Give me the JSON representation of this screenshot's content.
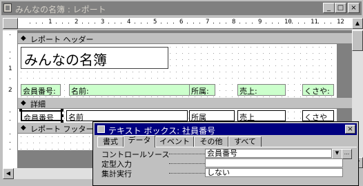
{
  "window": {
    "title": "みんなの名簿 : レポート",
    "minimize": "_",
    "maximize": "□",
    "close": "×"
  },
  "ruler": {
    "numbers": [
      "1",
      "2",
      "3",
      "4",
      "5",
      "6",
      "7",
      "8",
      "9",
      "10",
      "11",
      "12"
    ]
  },
  "vertical_ruler": {
    "marks": [
      "1",
      "2"
    ]
  },
  "sections": {
    "report_header": {
      "title": "レポート ヘッダー",
      "report_title": "みんなの名簿",
      "labels": [
        "会員番号:",
        "名前:",
        "所属:",
        "売上:",
        "くさや:"
      ]
    },
    "detail": {
      "title": "詳細",
      "fields": [
        "会員番号",
        "名前",
        "所属",
        "売上",
        "くさや"
      ]
    },
    "report_footer": {
      "title": "レポート フッター"
    }
  },
  "property_sheet": {
    "title": "テキスト ボックス: 社員番号",
    "tabs": [
      "書式",
      "データ",
      "イベント",
      "その他",
      "すべて"
    ],
    "active_tab": "データ",
    "properties": [
      {
        "label": "コントロールソース",
        "value": "会員番号"
      },
      {
        "label": "定型入力",
        "value": ""
      },
      {
        "label": "集計実行",
        "value": "しない"
      }
    ],
    "build_button": "...",
    "close": "×"
  },
  "colors": {
    "label_background": "#ccffcc",
    "active_titlebar": "#000080",
    "inactive_titlebar": "#808080"
  }
}
